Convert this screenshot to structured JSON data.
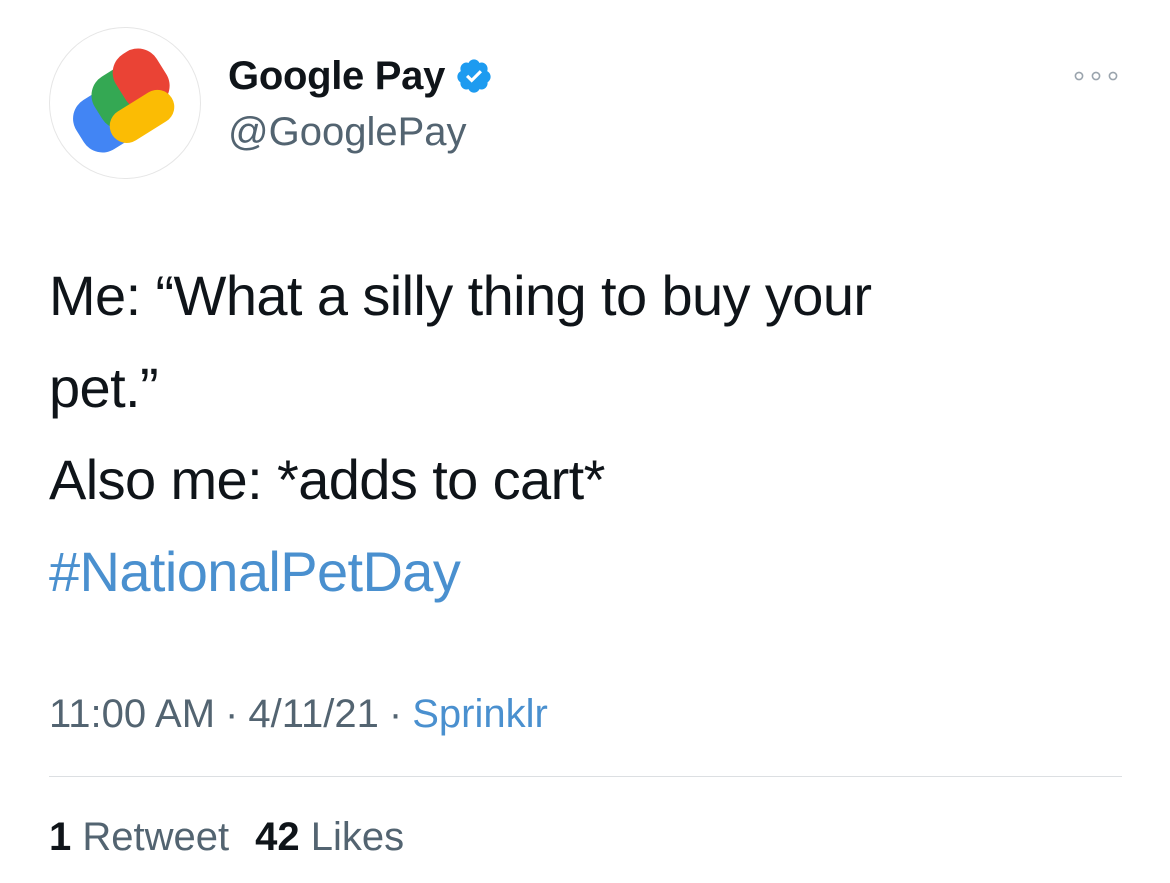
{
  "author": {
    "display_name": "Google Pay",
    "handle": "@GooglePay",
    "avatar_icon": "google-pay-logo",
    "verified_icon": "verified-badge-icon",
    "verified_color": "#1d9bf0"
  },
  "more_icon": "more-options-icon",
  "tweet": {
    "line_1": "Me: “What a silly thing to buy your",
    "line_2": "pet.”",
    "line_3": "Also me: *adds to cart*",
    "hashtag": "#NationalPetDay"
  },
  "meta": {
    "time": "11:00 AM",
    "separator": "·",
    "date": "4/11/21",
    "source": "Sprinklr"
  },
  "stats": {
    "retweets_count": "1",
    "retweets_label": "Retweet",
    "likes_count": "42",
    "likes_label": "Likes"
  },
  "colors": {
    "text": "#0f1419",
    "secondary": "#536471",
    "link": "#4a90cf",
    "divider": "#dcdfe2"
  }
}
